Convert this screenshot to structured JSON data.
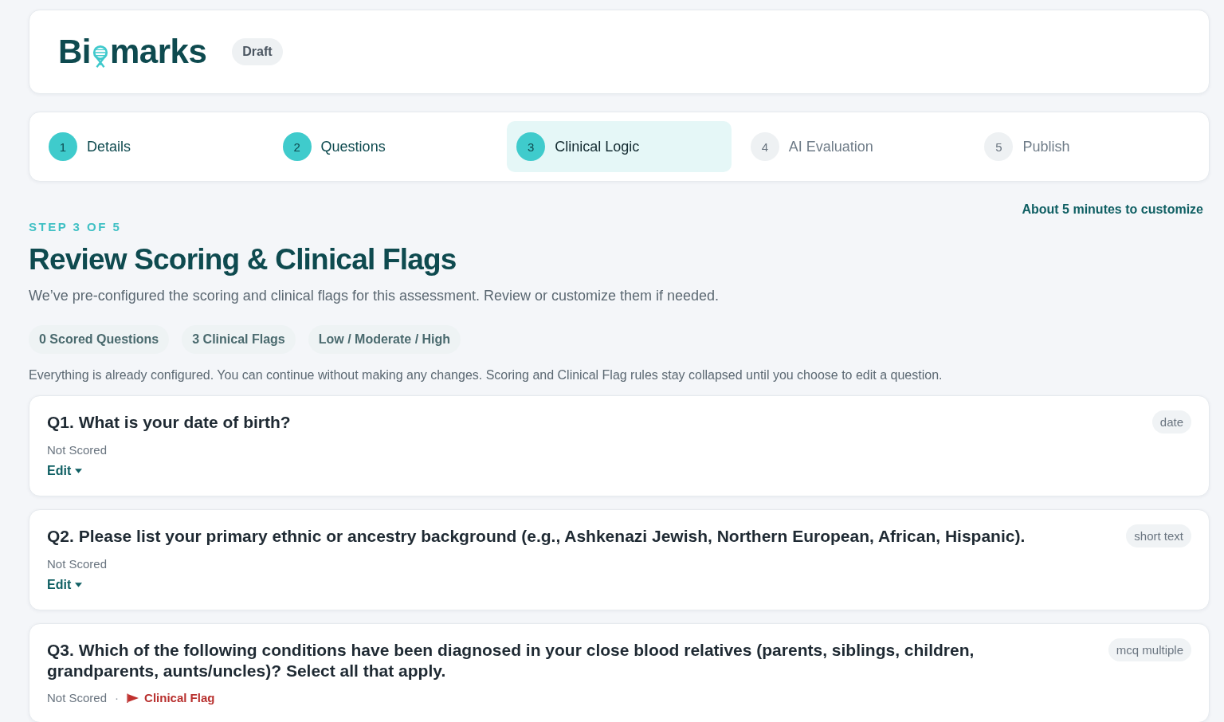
{
  "header": {
    "logo": {
      "before": "Bi",
      "after": "marks"
    },
    "badge": "Draft"
  },
  "steps": [
    {
      "number": "1",
      "label": "Details",
      "completed": true,
      "selected": false
    },
    {
      "number": "2",
      "label": "Questions",
      "completed": true,
      "selected": false
    },
    {
      "number": "3",
      "label": "Clinical Logic",
      "completed": false,
      "selected": true
    },
    {
      "number": "4",
      "label": "AI Evaluation",
      "completed": false,
      "selected": false
    },
    {
      "number": "5",
      "label": "Publish",
      "completed": false,
      "selected": false
    }
  ],
  "time_note": "About 5 minutes to customize",
  "eyebrow": "STEP 3 OF 5",
  "title": "Review Scoring & Clinical Flags",
  "subtitle": "We’ve pre-configured the scoring and clinical flags for this assessment. Review or customize them if needed.",
  "chips": [
    "0 Scored Questions",
    "3 Clinical Flags",
    "Low / Moderate / High"
  ],
  "note": "Everything is already configured. You can continue without making any changes. Scoring and Clinical Flag rules stay collapsed until you choose to edit a question.",
  "questions": [
    {
      "title": "Q1. What is your date of birth?",
      "type": "date",
      "scoring": "Not Scored",
      "edit": "Edit"
    },
    {
      "title": "Q2. Please list your primary ethnic or ancestry background (e.g., Ashkenazi Jewish, Northern European, African, Hispanic).",
      "type": "short text",
      "scoring": "Not Scored",
      "edit": "Edit"
    },
    {
      "title": "Q3. Which of the following conditions have been diagnosed in your close blood relatives (parents, siblings, children, grandparents, aunts/uncles)? Select all that apply.",
      "type": "mcq multiple",
      "scoring": "Not Scored",
      "separator": "·",
      "clinical_flag": "Clinical Flag"
    }
  ]
}
